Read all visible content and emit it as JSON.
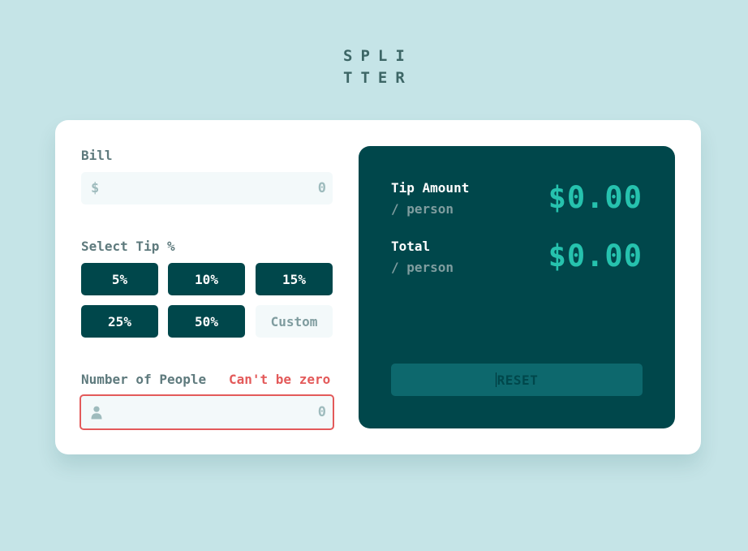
{
  "app": {
    "logo_line1": "SPLI",
    "logo_line2": "TTER"
  },
  "bill": {
    "label": "Bill",
    "currency_icon": "dollar-icon",
    "currency_symbol": "$",
    "placeholder": "0"
  },
  "tip": {
    "label": "Select Tip %",
    "options": [
      "5%",
      "10%",
      "15%",
      "25%",
      "50%"
    ],
    "custom_placeholder": "Custom"
  },
  "people": {
    "label": "Number of People",
    "error": "Can't be zero",
    "icon": "person-icon",
    "placeholder": "0"
  },
  "results": {
    "tip_amount_label": "Tip Amount",
    "tip_amount_sub": "/ person",
    "tip_amount_value": "$0.00",
    "total_label": "Total",
    "total_sub": "/ person",
    "total_value": "$0.00",
    "reset_label": "RESET"
  },
  "colors": {
    "background": "#c5e4e7",
    "card": "#ffffff",
    "panel": "#00474b",
    "accent": "#26c2ae",
    "error": "#e35a5a",
    "input_bg": "#f3f9fa",
    "reset_bg": "#0d686d"
  }
}
